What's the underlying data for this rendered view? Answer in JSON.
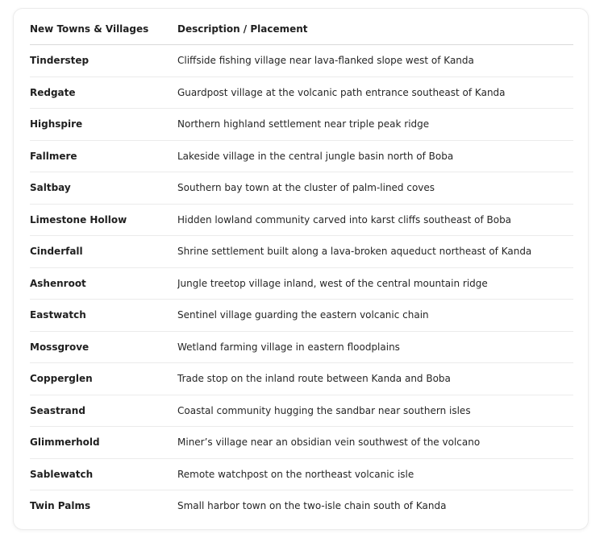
{
  "table": {
    "headers": [
      "New Towns & Villages",
      "Description / Placement"
    ],
    "rows": [
      {
        "name": "Tinderstep",
        "description": "Cliffside fishing village near lava-flanked slope west of Kanda"
      },
      {
        "name": "Redgate",
        "description": "Guardpost village at the volcanic path entrance southeast of Kanda"
      },
      {
        "name": "Highspire",
        "description": "Northern highland settlement near triple peak ridge"
      },
      {
        "name": "Fallmere",
        "description": "Lakeside village in the central jungle basin north of Boba"
      },
      {
        "name": "Saltbay",
        "description": "Southern bay town at the cluster of palm-lined coves"
      },
      {
        "name": "Limestone Hollow",
        "description": "Hidden lowland community carved into karst cliffs southeast of Boba"
      },
      {
        "name": "Cinderfall",
        "description": "Shrine settlement built along a lava-broken aqueduct northeast of Kanda"
      },
      {
        "name": "Ashenroot",
        "description": "Jungle treetop village inland, west of the central mountain ridge"
      },
      {
        "name": "Eastwatch",
        "description": "Sentinel village guarding the eastern volcanic chain"
      },
      {
        "name": "Mossgrove",
        "description": "Wetland farming village in eastern floodplains"
      },
      {
        "name": "Copperglen",
        "description": "Trade stop on the inland route between Kanda and Boba"
      },
      {
        "name": "Seastrand",
        "description": "Coastal community hugging the sandbar near southern isles"
      },
      {
        "name": "Glimmerhold",
        "description": "Miner’s village near an obsidian vein southwest of the volcano"
      },
      {
        "name": "Sablewatch",
        "description": "Remote watchpost on the northeast volcanic isle"
      },
      {
        "name": "Twin Palms",
        "description": "Small harbor town on the two-isle chain south of Kanda"
      }
    ]
  }
}
